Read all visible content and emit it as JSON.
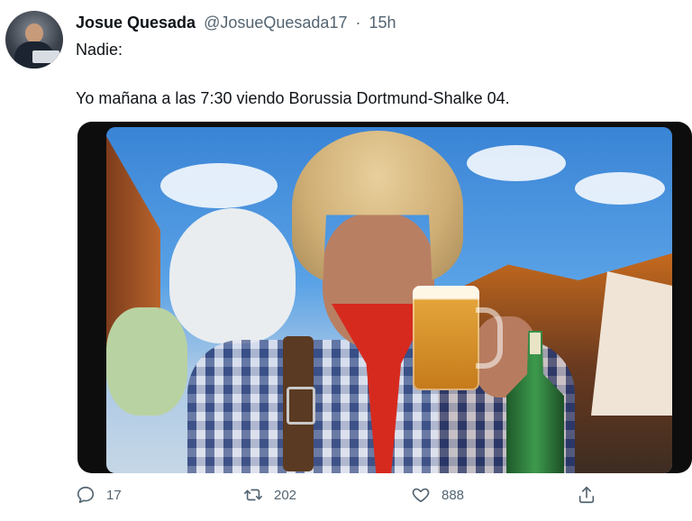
{
  "tweet": {
    "display_name": "Josue Quesada",
    "handle": "@JosueQuesada17",
    "separator": "·",
    "time_ago": "15h",
    "text_line1": "Nadie:",
    "text_line2": "Yo mañana a las 7:30 viendo Borussia Dortmund-Shalke 04."
  },
  "actions": {
    "reply_icon": "reply-icon",
    "reply_count": "17",
    "retweet_icon": "retweet-icon",
    "retweet_count": "202",
    "like_icon": "heart-icon",
    "like_count": "888",
    "share_icon": "share-icon"
  },
  "colors": {
    "text_primary": "#0f1419",
    "text_secondary": "#536471",
    "background": "#ffffff"
  }
}
